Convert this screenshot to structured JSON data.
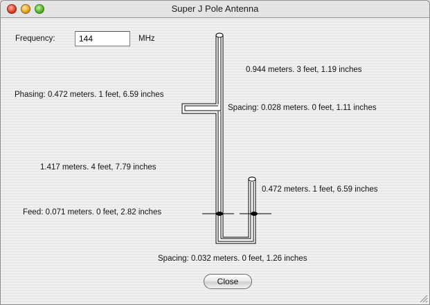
{
  "window": {
    "title": "Super J Pole Antenna"
  },
  "frequency": {
    "label": "Frequency:",
    "value": "144",
    "unit": "MHz"
  },
  "labels": {
    "top_length": "0.944 meters.  3 feet, 1.19 inches",
    "phasing": "Phasing: 0.472 meters.  1 feet, 6.59 inches",
    "spacing_top": "Spacing: 0.028 meters.  0 feet, 1.11 inches",
    "long_length": "1.417 meters.  4 feet, 7.79 inches",
    "stub_length": "0.472 meters.  1 feet, 6.59 inches",
    "feed": "Feed: 0.071 meters.  0 feet, 2.82 inches",
    "spacing_bottom": "Spacing: 0.032 meters.  0 feet, 1.26 inches"
  },
  "buttons": {
    "close_label": "Close"
  }
}
